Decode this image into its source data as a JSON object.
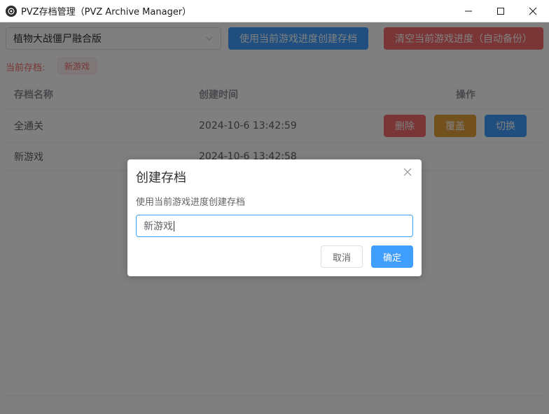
{
  "window": {
    "title": "PVZ存档管理（PVZ Archive Manager）",
    "controls": [
      "minimize-icon",
      "maximize-icon",
      "close-icon"
    ]
  },
  "toolbar": {
    "game_select_value": "植物大战僵尸融合版",
    "create_button_label": "使用当前游戏进度创建存档",
    "clear_button_label": "清空当前游戏进度（自动备份）"
  },
  "current_archive": {
    "label": "当前存档:",
    "value": "新游戏"
  },
  "table": {
    "columns": [
      "存档名称",
      "创建时间",
      "操作"
    ],
    "rows": [
      {
        "name": "全通关",
        "time": "2024-10-6 13:42:59",
        "actions": [
          "删除",
          "覆盖",
          "切换"
        ]
      },
      {
        "name": "新游戏",
        "time": "2024-10-6 13:42:58"
      }
    ]
  },
  "dialog": {
    "title": "创建存档",
    "message": "使用当前游戏进度创建存档",
    "input_value": "新游戏",
    "cancel_label": "取消",
    "confirm_label": "确定"
  },
  "colors": {
    "primary": "#409eff",
    "danger": "#f56c6c",
    "warning": "#e6a23c",
    "overlay": "rgba(0,0,0,0.5)"
  }
}
